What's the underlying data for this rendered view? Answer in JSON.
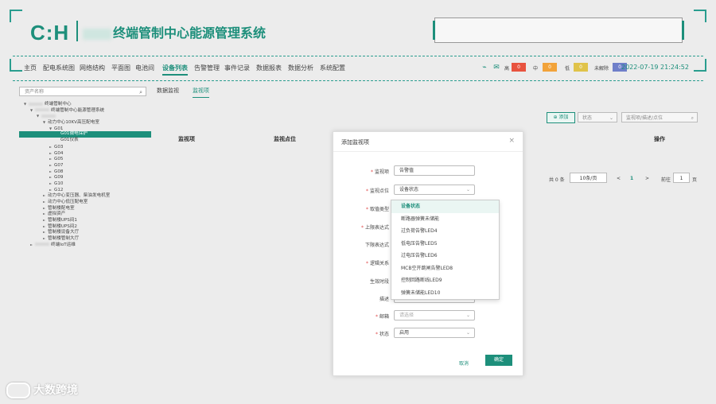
{
  "header": {
    "logo": "C:H",
    "system_title": "终端管制中心能源管理系统"
  },
  "nav": {
    "items": [
      "主页",
      "配电系统图",
      "网络结构",
      "平面图",
      "电池间",
      "设备列表",
      "告警管理",
      "事件记录",
      "数据报表",
      "数据分析",
      "系统配置"
    ],
    "active_index": 5
  },
  "alarm_levels": [
    {
      "label": "高",
      "count": "0",
      "color": "#e8533f"
    },
    {
      "label": "中",
      "count": "0",
      "color": "#f2a33a"
    },
    {
      "label": "低",
      "count": "0",
      "color": "#e0c34a"
    },
    {
      "label": "未解除",
      "count": "0",
      "color": "#6f7fc9"
    }
  ],
  "clock": "2022-07-19 21:24:52",
  "sidebar": {
    "search_placeholder": "资产名称",
    "tree": [
      {
        "label": "终端管制中心",
        "level": 0,
        "arrow": "▼",
        "blur": true
      },
      {
        "label": "终端管制中心能源管理系统",
        "level": 1,
        "arrow": "▼",
        "blur": true
      },
      {
        "label": "",
        "level": 2,
        "arrow": "▼",
        "blur": true
      },
      {
        "label": "动力中心10KV高压配电室",
        "level": 3,
        "arrow": "▼",
        "blur": false
      },
      {
        "label": "G01",
        "level": 4,
        "arrow": "▼",
        "blur": false
      },
      {
        "label": "G01微电保护",
        "level": 5,
        "arrow": "",
        "blur": false,
        "selected": true
      },
      {
        "label": "G01仪表",
        "level": 5,
        "arrow": "",
        "blur": false
      },
      {
        "label": "G03",
        "level": 4,
        "arrow": "►",
        "blur": false
      },
      {
        "label": "G04",
        "level": 4,
        "arrow": "►",
        "blur": false
      },
      {
        "label": "G05",
        "level": 4,
        "arrow": "►",
        "blur": false
      },
      {
        "label": "G07",
        "level": 4,
        "arrow": "►",
        "blur": false
      },
      {
        "label": "G08",
        "level": 4,
        "arrow": "►",
        "blur": false
      },
      {
        "label": "G09",
        "level": 4,
        "arrow": "►",
        "blur": false
      },
      {
        "label": "G10",
        "level": 4,
        "arrow": "►",
        "blur": false
      },
      {
        "label": "G12",
        "level": 4,
        "arrow": "►",
        "blur": false
      },
      {
        "label": "动力中心变压器、柴油发电机室",
        "level": 3,
        "arrow": "►",
        "blur": false
      },
      {
        "label": "动力中心低压配电室",
        "level": 3,
        "arrow": "►",
        "blur": false
      },
      {
        "label": "管制楼配电室",
        "level": 3,
        "arrow": "►",
        "blur": false
      },
      {
        "label": "虚拟资产",
        "level": 3,
        "arrow": "►",
        "blur": false
      },
      {
        "label": "管制楼UPS间1",
        "level": 3,
        "arrow": "►",
        "blur": false
      },
      {
        "label": "管制楼UPS间2",
        "level": 3,
        "arrow": "►",
        "blur": false
      },
      {
        "label": "管制楼设备大厅",
        "level": 3,
        "arrow": "►",
        "blur": false
      },
      {
        "label": "管制楼管制大厅",
        "level": 3,
        "arrow": "►",
        "blur": false
      },
      {
        "label": "终端IoT运维",
        "level": 1,
        "arrow": "►",
        "blur": true
      }
    ]
  },
  "main": {
    "tabs": [
      "数据监视",
      "监视项"
    ],
    "active_tab": 1,
    "add_label": "添加",
    "status_placeholder": "状态",
    "search_placeholder": "监视项/描述/点位",
    "table_headers": [
      "监视项",
      "监视点位",
      "操作"
    ],
    "pagination": {
      "total": "共 0 条",
      "page_size": "10条/页",
      "prev": "<",
      "page": "1",
      "next": ">",
      "goto_label": "前往",
      "goto_value": "1",
      "page_unit": "页"
    }
  },
  "dialog": {
    "title": "添加监视项",
    "close": "×",
    "fields": [
      {
        "label": "监视项",
        "required": true,
        "value": "告警值",
        "placeholder": false,
        "select": false
      },
      {
        "label": "监视点位",
        "required": true,
        "value": "设备状态",
        "placeholder": false,
        "select": true
      },
      {
        "label": "取值类型",
        "required": true,
        "value": "",
        "placeholder": false,
        "select": false
      },
      {
        "label": "上限表达式",
        "required": true,
        "value": "",
        "placeholder": false,
        "select": false
      },
      {
        "label": "下限表达式",
        "required": false,
        "value": "",
        "placeholder": false,
        "select": false
      },
      {
        "label": "逻辑关系",
        "required": true,
        "value": "",
        "placeholder": false,
        "select": false
      },
      {
        "label": "生效时段",
        "required": false,
        "value": "",
        "placeholder": false,
        "select": false
      },
      {
        "label": "描述",
        "required": false,
        "value": "",
        "placeholder": false,
        "select": false
      },
      {
        "label": "邮箱",
        "required": true,
        "value": "请选择",
        "placeholder": true,
        "select": true
      },
      {
        "label": "状态",
        "required": true,
        "value": "启用",
        "placeholder": false,
        "select": true
      }
    ],
    "cancel_label": "取消",
    "ok_label": "确定"
  },
  "dropdown": {
    "options": [
      "设备状态",
      "断路器弹簧未储能",
      "过负荷告警LED4",
      "低电压告警LED5",
      "过电压告警LED6",
      "MCB空开跳闸告警LED8",
      "控制回路断线LED9",
      "弹簧未储能LED10"
    ],
    "active_index": 0
  },
  "watermark": "大数跨境"
}
